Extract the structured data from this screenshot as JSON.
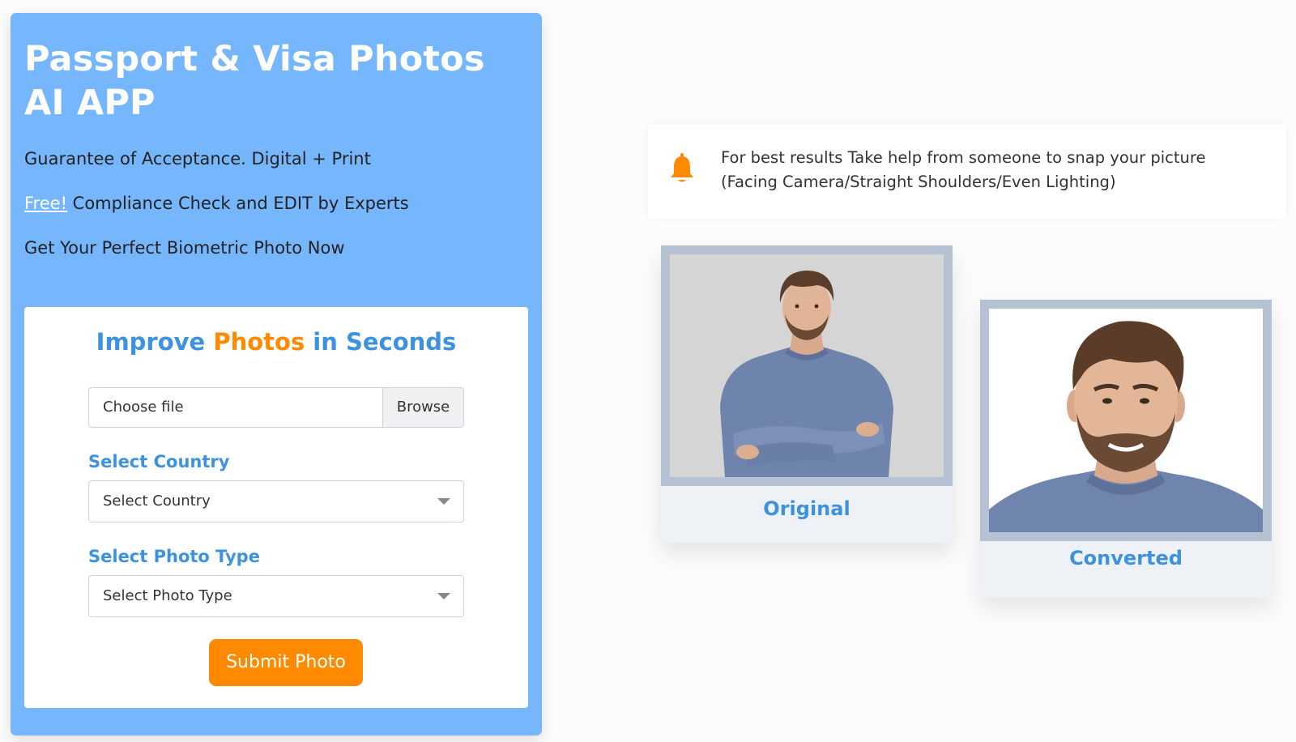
{
  "hero": {
    "title": "Passport & Visa Photos AI APP",
    "line1": "Guarantee of Acceptance. Digital + Print",
    "free_link": "Free!",
    "line2_rest": " Compliance Check and EDIT by Experts",
    "line3": "Get Your Perfect Biometric Photo Now"
  },
  "form": {
    "heading_part1": "Improve ",
    "heading_part2": "Photos",
    "heading_part3": " in Seconds",
    "file_placeholder": "Choose file",
    "browse_label": "Browse",
    "country_label": "Select Country",
    "country_value": "Select Country",
    "photo_type_label": "Select Photo Type",
    "photo_type_value": "Select Photo Type",
    "submit_label": "Submit Photo"
  },
  "tip": {
    "icon": "bell-icon",
    "text": "For best results Take help from someone to snap your picture (Facing Camera/Straight Shoulders/Even Lighting)"
  },
  "examples": {
    "original_label": "Original",
    "converted_label": "Converted"
  },
  "colors": {
    "hero_bg": "#75b6fc",
    "accent_blue": "#3d92e0",
    "accent_orange": "#ff8a00",
    "frame": "#b4c2d3"
  }
}
